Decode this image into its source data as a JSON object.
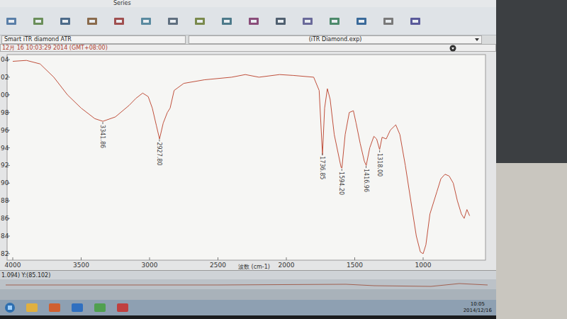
{
  "window": {
    "title": "Smart iTR diamond ATR",
    "experiment": "(iTR Diamond.exp)"
  },
  "menu": [
    "Series"
  ],
  "timestamp": "12月 16 10:03:29 2014 (GMT+08:00)",
  "chart": {
    "x_axis": {
      "label": "波数 (cm-1)",
      "ticks": [
        "4000",
        "3500",
        "3000",
        "2500",
        "2000",
        "1500",
        "1000"
      ]
    },
    "y_axis": {
      "ticks": [
        {
          "label": "04",
          "value": 104
        },
        {
          "label": "02",
          "value": 102
        },
        {
          "label": "00",
          "value": 100
        },
        {
          "label": "98",
          "value": 98
        },
        {
          "label": "96",
          "value": 96
        },
        {
          "label": "94",
          "value": 94
        },
        {
          "label": "92",
          "value": 92
        },
        {
          "label": "90",
          "value": 90
        },
        {
          "label": "88",
          "value": 88
        },
        {
          "label": "86",
          "value": 86
        },
        {
          "label": "84",
          "value": 84
        },
        {
          "label": "82",
          "value": 82
        }
      ]
    },
    "series": [
      {
        "wavenumbers": [
          4000,
          3900,
          3800,
          3700,
          3600,
          3500,
          3400,
          3341,
          3250,
          3150,
          3100,
          3050,
          3010,
          2980,
          2950,
          2927,
          2900,
          2870,
          2850,
          2820,
          2750,
          2600,
          2400,
          2300,
          2200,
          2050,
          1950,
          1800,
          1760,
          1736,
          1720,
          1700,
          1680,
          1650,
          1600,
          1594,
          1570,
          1540,
          1510,
          1490,
          1460,
          1430,
          1416,
          1390,
          1360,
          1340,
          1318,
          1300,
          1270,
          1240,
          1200,
          1170,
          1130,
          1090,
          1050,
          1020,
          1000,
          980,
          950,
          900,
          870,
          840,
          810,
          780,
          750,
          720,
          700,
          680,
          660
        ],
        "values": [
          103.8,
          103.9,
          103.5,
          102.0,
          100.0,
          98.5,
          97.3,
          97.0,
          97.5,
          98.8,
          99.6,
          100.2,
          99.8,
          98.5,
          96.5,
          95.0,
          96.8,
          98.0,
          98.5,
          100.5,
          101.3,
          101.7,
          102.0,
          102.3,
          102.0,
          102.3,
          102.2,
          102.0,
          100.5,
          93.2,
          98.5,
          100.7,
          99.5,
          95.5,
          91.8,
          91.7,
          95.5,
          98.0,
          98.2,
          96.8,
          94.5,
          92.5,
          92.0,
          94.0,
          95.3,
          95.0,
          93.8,
          95.2,
          95.0,
          96.0,
          96.6,
          95.5,
          92.0,
          88.0,
          84.0,
          82.2,
          82.0,
          83.0,
          86.5,
          89.0,
          90.5,
          91.0,
          90.8,
          90.0,
          88.0,
          86.5,
          86.0,
          87.0,
          86.3
        ]
      }
    ],
    "peaks": [
      {
        "label": "3341.86"
      },
      {
        "label": "2927.80"
      },
      {
        "label": "1736.85"
      },
      {
        "label": "1594.20"
      },
      {
        "label": "1416.96"
      },
      {
        "label": "1318.00"
      }
    ]
  },
  "status_bar": {
    "cursor": "1.094) Y:(85.102)"
  },
  "taskbar": {
    "time": "10:05",
    "date": "2014/12/16"
  }
}
